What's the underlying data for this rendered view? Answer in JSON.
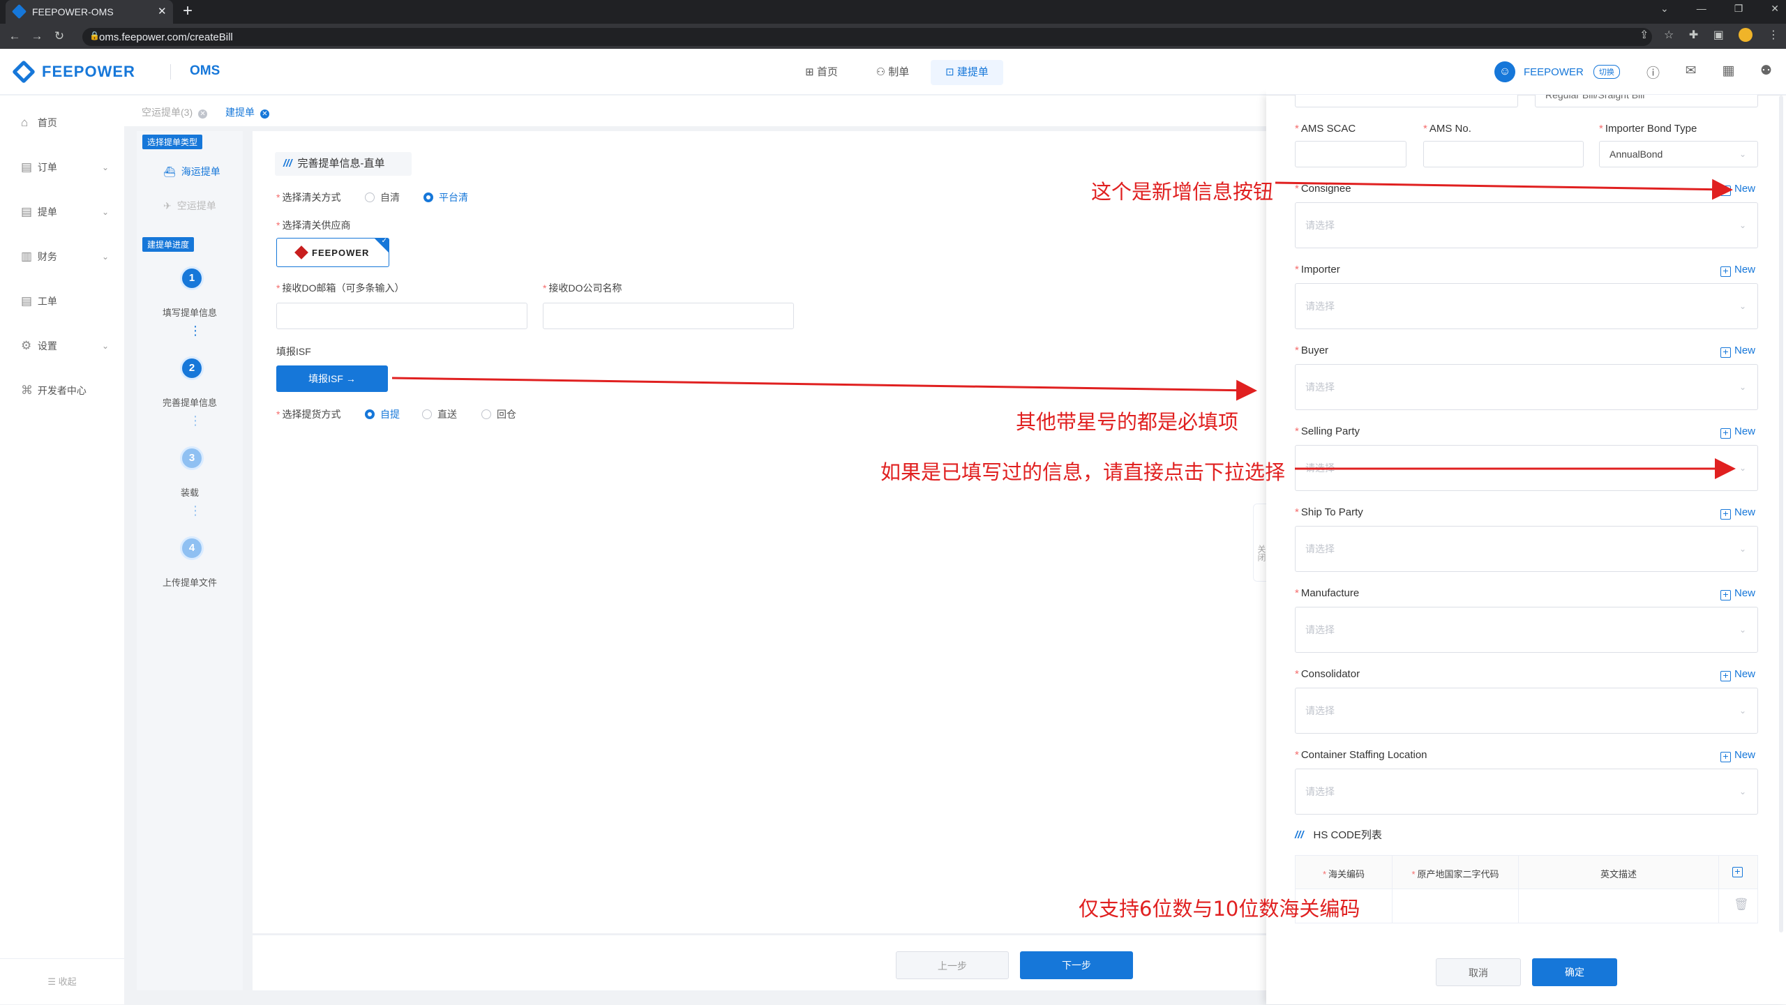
{
  "browser": {
    "tab_title": "FEEPOWER-OMS",
    "new_tab": "+",
    "url": "oms.feepower.com/createBill",
    "window_controls": [
      "⌄",
      "—",
      "❐",
      "✕"
    ]
  },
  "header": {
    "logo_text": "FEEPOWER",
    "product": "OMS",
    "nav": [
      {
        "label": "首页",
        "icon": "grid-icon"
      },
      {
        "label": "制单",
        "icon": "user-icon"
      },
      {
        "label": "建提单",
        "icon": "doc-plus-icon",
        "active": true
      }
    ],
    "company": "FEEPOWER",
    "switch_label": "切换"
  },
  "sidebar": {
    "items": [
      {
        "label": "首页",
        "icon": "home-icon",
        "has_children": false
      },
      {
        "label": "订单",
        "icon": "order-icon",
        "has_children": true
      },
      {
        "label": "提单",
        "icon": "bill-icon",
        "has_children": true
      },
      {
        "label": "财务",
        "icon": "finance-icon",
        "has_children": true
      },
      {
        "label": "工单",
        "icon": "ticket-icon",
        "has_children": false
      },
      {
        "label": "设置",
        "icon": "gear-icon",
        "has_children": true
      },
      {
        "label": "开发者中心",
        "icon": "code-icon",
        "has_children": false
      }
    ],
    "collapse_label": "收起"
  },
  "crumbs": [
    {
      "label": "空运提单(3)",
      "active": false
    },
    {
      "label": "建提单",
      "active": true
    }
  ],
  "steps_panel": {
    "type_tag": "选择提单类型",
    "types": [
      {
        "label": "海运提单",
        "active": true
      },
      {
        "label": "空运提单",
        "active": false
      }
    ],
    "progress_tag": "建提单进度",
    "steps": [
      {
        "num": "1",
        "label": "填写提单信息",
        "done": true
      },
      {
        "num": "2",
        "label": "完善提单信息",
        "done": true
      },
      {
        "num": "3",
        "label": "装载",
        "done": false
      },
      {
        "num": "4",
        "label": "上传提单文件",
        "done": false
      }
    ]
  },
  "form": {
    "section_title": "完善提单信息-直单",
    "customs_label": "选择清关方式",
    "customs_options": [
      "自清",
      "平台清"
    ],
    "customs_selected": "平台清",
    "supplier_label": "选择清关供应商",
    "supplier_name": "FEEPOWER",
    "do_email_label": "接收DO邮箱（可多条输入）",
    "do_email_value": "",
    "do_company_label": "接收DO公司名称",
    "do_company_value": "",
    "isf_label": "填报ISF",
    "isf_button": "填报ISF →",
    "pickup_label": "选择提货方式",
    "pickup_options": [
      "自提",
      "直送",
      "回仓"
    ],
    "pickup_selected": "自提"
  },
  "bottom": {
    "prev": "上一步",
    "next": "下一步"
  },
  "drawer": {
    "side_tab": "关闭",
    "top_fields": {
      "partial_left": "",
      "partial_right": "Regular Bill/Sraight Bill",
      "ams_scac_label": "AMS SCAC",
      "ams_no_label": "AMS No.",
      "bond_type_label": "Importer Bond Type",
      "bond_type_value": "AnnualBond"
    },
    "new_label": "New",
    "placeholder": "请选择",
    "parties": [
      "Consignee",
      "Importer",
      "Buyer",
      "Selling Party",
      "Ship To Party",
      "Manufacture",
      "Consolidator",
      "Container Staffing Location"
    ],
    "hs_title": "HS CODE列表",
    "hs_headers": [
      "海关编码",
      "原产地国家二字代码",
      "英文描述"
    ],
    "cancel": "取消",
    "confirm": "确定"
  },
  "annotations": {
    "new_button": "这个是新增信息按钮",
    "required": "其他带星号的都是必填项",
    "dropdown": "如果是已填写过的信息，请直接点击下拉选择",
    "hs_code": "仅支持6位数与10位数海关编码"
  },
  "colors": {
    "primary": "#1677d9",
    "required_star": "#f56c6c",
    "annotation_red": "#e02020"
  }
}
